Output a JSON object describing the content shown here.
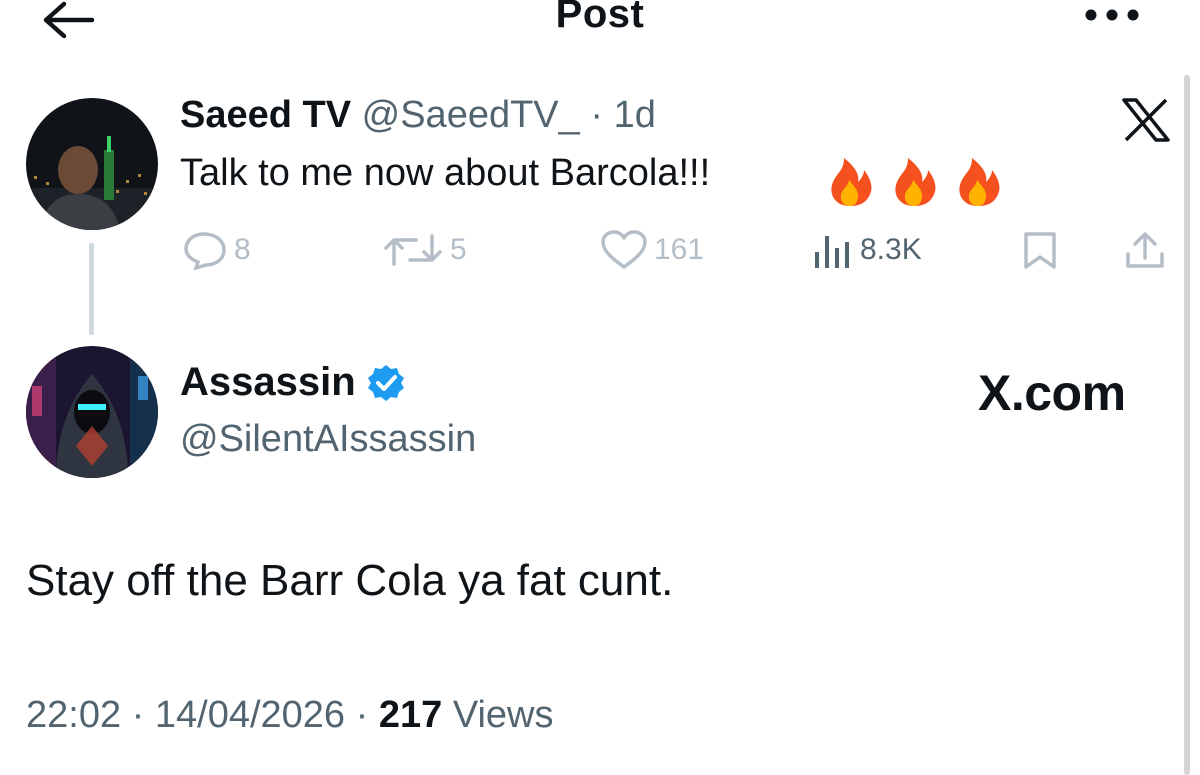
{
  "header": {
    "title": "Post",
    "back_icon": "arrow-left-icon",
    "more_icon": "more-dots-icon"
  },
  "original_post": {
    "display_name": "Saeed TV",
    "handle": "@SaeedTV_",
    "separator": "·",
    "age": "1d",
    "text": "Talk to me now about Barcola!!!",
    "emojis": [
      "fire",
      "fire",
      "fire"
    ],
    "x_logo": "X",
    "actions": {
      "replies": "8",
      "reposts": "5",
      "likes": "161",
      "views": "8.3K"
    }
  },
  "reply_post": {
    "display_name": "Assassin",
    "verified": true,
    "handle": "@SilentAIssassin",
    "watermark": "X.com",
    "text": "Stay off the Barr Cola ya fat cunt.",
    "time": "22:02",
    "date": "14/04/2026",
    "separator": "·",
    "views_count": "217",
    "views_label": "Views"
  },
  "colors": {
    "text": "#0f1419",
    "muted": "#536471",
    "icon_muted": "#b5bec7",
    "verified": "#1d9bf0",
    "thread_line": "#cfd9de"
  }
}
